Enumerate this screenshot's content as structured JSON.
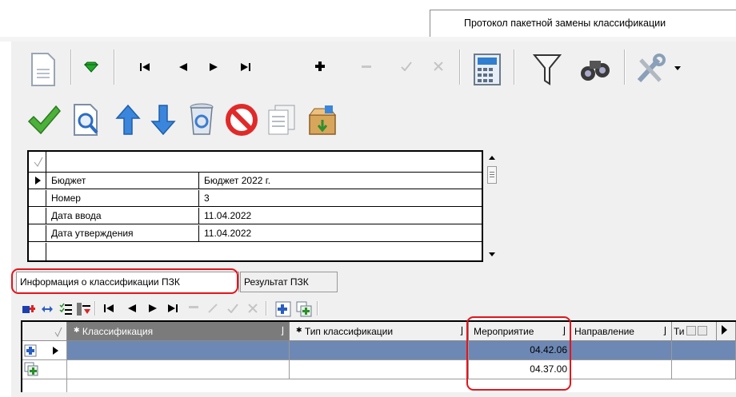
{
  "window_tab": {
    "title": "Протокол пакетной замены классификации"
  },
  "toolbar_main": {
    "icons": [
      "document-icon",
      "filter-diamond-icon",
      "first-record-icon",
      "prev-record-icon",
      "next-record-icon",
      "last-record-icon",
      "add-record-icon",
      "delete-record-icon",
      "post-record-icon",
      "cancel-record-icon",
      "calculator-icon",
      "funnel-icon",
      "binoculars-icon",
      "tools-icon",
      "dropdown-arrow-icon"
    ]
  },
  "toolbar_actions": {
    "icons": [
      "checkmark-icon",
      "preview-icon",
      "arrow-up-icon",
      "arrow-down-icon",
      "recycle-bin-icon",
      "stop-icon",
      "copy-icon",
      "archive-box-icon"
    ]
  },
  "properties": [
    {
      "name": "Бюджет",
      "value": "Бюджет 2022 г."
    },
    {
      "name": "Номер",
      "value": "3"
    },
    {
      "name": "Дата ввода",
      "value": "11.04.2022"
    },
    {
      "name": "Дата утверждения",
      "value": "11.04.2022"
    }
  ],
  "tabs": [
    {
      "label": "Информация о классификации ПЗК",
      "active": true
    },
    {
      "label": "Результат ПЗК",
      "active": false
    }
  ],
  "grid": {
    "columns": [
      "Классификация",
      "Тип классификации",
      "Мероприятие",
      "Направление",
      "Ти"
    ],
    "rows": [
      {
        "classification": "",
        "type": "",
        "event": "04.42.06",
        "direction": "",
        "ti": ""
      },
      {
        "classification": "",
        "type": "",
        "event": "04.37.00",
        "direction": "",
        "ti": ""
      }
    ]
  },
  "colors": {
    "highlight": "#e4141b",
    "selected_row": "#6d88b4",
    "header_selected": "#7b7b7b"
  }
}
